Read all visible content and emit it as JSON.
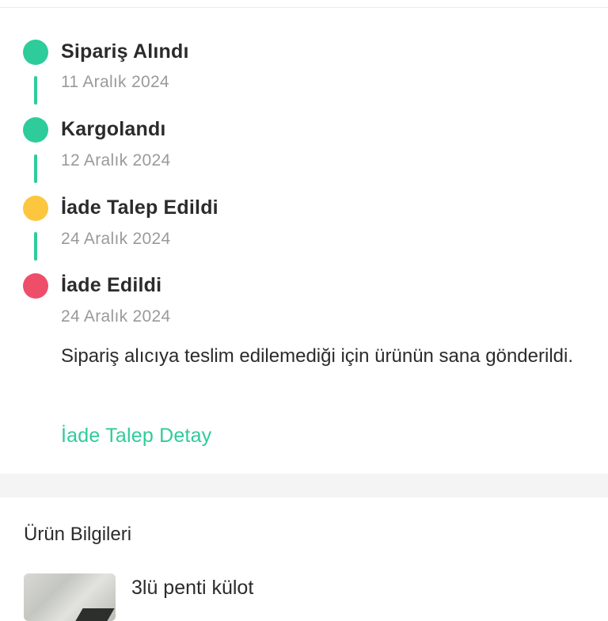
{
  "timeline": {
    "steps": [
      {
        "title": "Sipariş Alındı",
        "date": "11 Aralık 2024",
        "status_color": "#2ecc9a"
      },
      {
        "title": "Kargolandı",
        "date": "12 Aralık 2024",
        "status_color": "#2ecc9a"
      },
      {
        "title": "İade Talep Edildi",
        "date": "24 Aralık 2024",
        "status_color": "#fcc63f"
      },
      {
        "title": "İade Edildi",
        "date": "24 Aralık 2024",
        "status_color": "#ee4e6a"
      }
    ],
    "connector_color": "#2ecc9a",
    "note": "Sipariş alıcıya teslim edilemediği için ürünün sana gönderildi.",
    "detail_link": "İade Talep Detay"
  },
  "product": {
    "section_title": "Ürün Bilgileri",
    "name": "3lü penti külot"
  },
  "colors": {
    "accent": "#2ecc9a",
    "pending": "#fcc63f",
    "returned": "#ee4e6a"
  }
}
